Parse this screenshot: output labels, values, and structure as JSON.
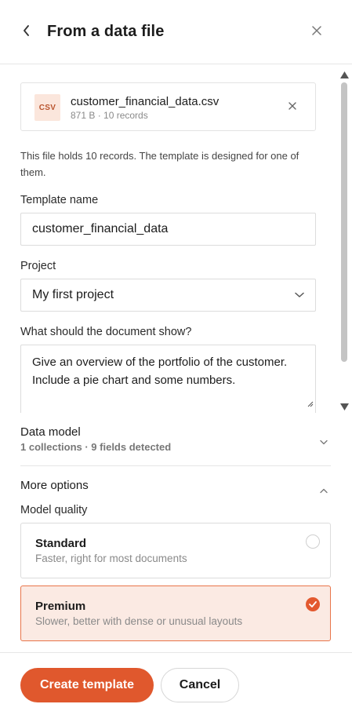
{
  "header": {
    "title": "From a data file"
  },
  "file": {
    "badge": "CSV",
    "name": "customer_financial_data.csv",
    "meta": "871 B · 10 records"
  },
  "info_text": "This file holds 10 records. The template is designed for one of them.",
  "template_name": {
    "label": "Template name",
    "value": "customer_financial_data"
  },
  "project": {
    "label": "Project",
    "selected": "My first project"
  },
  "document_prompt": {
    "label": "What should the document show?",
    "value": "Give an overview of the portfolio of the customer. Include a pie chart and some numbers."
  },
  "data_model": {
    "title": "Data model",
    "subtitle": "1 collections · 9 fields detected",
    "expanded": false
  },
  "more_options": {
    "title": "More options",
    "expanded": true,
    "model_quality_label": "Model quality",
    "options": [
      {
        "title": "Standard",
        "description": "Faster, right for most documents",
        "selected": false
      },
      {
        "title": "Premium",
        "description": "Slower, better with dense or unusual layouts",
        "selected": true
      }
    ]
  },
  "footer": {
    "primary_label": "Create template",
    "secondary_label": "Cancel"
  },
  "colors": {
    "accent": "#e0582d",
    "selected_bg": "#fbeae3",
    "badge_bg": "#fbe6dc"
  },
  "icons": {
    "back": "chevron-left-icon",
    "close": "close-icon",
    "file_remove": "close-icon",
    "select": "chevron-down-icon",
    "data_model": "chevron-down-icon",
    "more_options": "chevron-up-icon",
    "radio_checked": "check-icon"
  }
}
